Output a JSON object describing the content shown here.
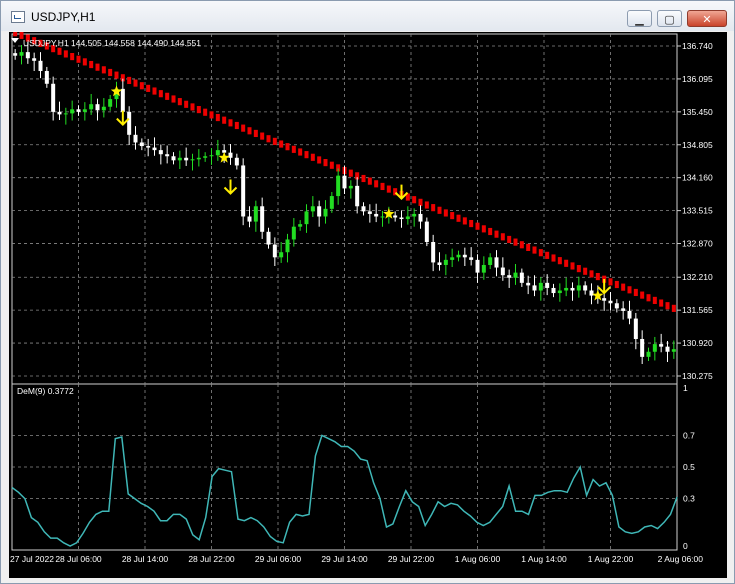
{
  "window": {
    "title": "USDJPY,H1",
    "minimize_icon": "minimize-icon",
    "maximize_icon": "maximize-icon",
    "close_icon": "close-icon"
  },
  "colors": {
    "background": "#000000",
    "grid": "#8a8a8a",
    "bull_candle": "#22dd22",
    "bear_candle": "#ffffff",
    "ma_line": "#ee0000",
    "signal_marker": "#ffee00",
    "dem_line": "#3fb7b7",
    "text": "#ffffff"
  },
  "chart_data": [
    {
      "type": "candlestick",
      "header": "USDJPY,H1  144.505 144.558 144.490 144.551",
      "ylim": [
        130.275,
        136.74
      ],
      "y_ticks": [
        "136.740",
        "136.095",
        "135.450",
        "134.805",
        "134.160",
        "133.515",
        "132.870",
        "132.210",
        "131.565",
        "130.920",
        "130.275"
      ],
      "x_ticks": [
        "27 Jul 2022",
        "28 Jul 06:00",
        "28 Jul 14:00",
        "28 Jul 22:00",
        "29 Jul 06:00",
        "29 Jul 14:00",
        "29 Jul 22:00",
        "1 Aug 06:00",
        "1 Aug 14:00",
        "1 Aug 22:00",
        "2 Aug 06:00"
      ],
      "grid": true,
      "candles_close": [
        136.55,
        136.62,
        136.5,
        136.45,
        136.25,
        136.0,
        135.45,
        135.4,
        135.42,
        135.5,
        135.45,
        135.5,
        135.6,
        135.48,
        135.55,
        135.7,
        135.9,
        135.45,
        135.0,
        134.85,
        134.78,
        134.75,
        134.7,
        134.62,
        134.58,
        134.5,
        134.55,
        134.5,
        134.52,
        134.55,
        134.58,
        134.6,
        134.7,
        134.65,
        134.55,
        134.4,
        133.4,
        133.3,
        133.6,
        133.1,
        132.85,
        132.6,
        132.7,
        132.95,
        133.2,
        133.25,
        133.5,
        133.6,
        133.4,
        133.55,
        133.8,
        134.2,
        133.95,
        134.0,
        133.6,
        133.5,
        133.45,
        133.4,
        133.4,
        133.42,
        133.38,
        133.35,
        133.4,
        133.45,
        133.3,
        132.9,
        132.5,
        132.45,
        132.55,
        132.6,
        132.65,
        132.6,
        132.55,
        132.3,
        132.45,
        132.6,
        132.4,
        132.25,
        132.2,
        132.3,
        132.1,
        132.05,
        131.95,
        132.1,
        132.0,
        131.9,
        131.95,
        132.0,
        131.95,
        132.05,
        131.95,
        131.85,
        131.8,
        131.75,
        131.7,
        131.6,
        131.55,
        131.4,
        131.0,
        130.65,
        130.75,
        130.9,
        130.85,
        130.75,
        130.8
      ],
      "ma_values": [
        137.0,
        131.6
      ],
      "signals": [
        {
          "type": "star",
          "index": 16,
          "price": 135.85
        },
        {
          "type": "arrow-down",
          "index": 17,
          "price": 135.2
        },
        {
          "type": "star",
          "index": 33,
          "price": 134.55
        },
        {
          "type": "arrow-down",
          "index": 34,
          "price": 133.85
        },
        {
          "type": "star",
          "index": 59,
          "price": 133.45
        },
        {
          "type": "arrow-down",
          "index": 61,
          "price": 133.75
        },
        {
          "type": "star",
          "index": 92,
          "price": 131.85
        },
        {
          "type": "arrow-down",
          "index": 93,
          "price": 131.9
        }
      ]
    },
    {
      "type": "line",
      "header": "DeM(9) 0.3772",
      "ylim": [
        0,
        1
      ],
      "y_ticks": [
        "1",
        "0.7",
        "0.5",
        "0.3",
        "0"
      ],
      "series": [
        {
          "name": "DeM(9)",
          "values": [
            0.37,
            0.34,
            0.3,
            0.18,
            0.15,
            0.09,
            0.05,
            0.05,
            0.02,
            0.0,
            0.02,
            0.08,
            0.15,
            0.2,
            0.22,
            0.22,
            0.68,
            0.69,
            0.33,
            0.3,
            0.27,
            0.25,
            0.22,
            0.16,
            0.16,
            0.2,
            0.2,
            0.17,
            0.07,
            0.04,
            0.18,
            0.44,
            0.49,
            0.48,
            0.47,
            0.17,
            0.16,
            0.18,
            0.16,
            0.12,
            0.06,
            0.03,
            0.02,
            0.15,
            0.2,
            0.19,
            0.2,
            0.57,
            0.7,
            0.68,
            0.66,
            0.63,
            0.63,
            0.6,
            0.55,
            0.54,
            0.4,
            0.3,
            0.12,
            0.14,
            0.25,
            0.35,
            0.28,
            0.25,
            0.13,
            0.2,
            0.28,
            0.25,
            0.27,
            0.26,
            0.22,
            0.19,
            0.15,
            0.13,
            0.15,
            0.2,
            0.25,
            0.38,
            0.22,
            0.22,
            0.2,
            0.32,
            0.32,
            0.34,
            0.35,
            0.35,
            0.34,
            0.43,
            0.5,
            0.32,
            0.42,
            0.38,
            0.4,
            0.32,
            0.12,
            0.09,
            0.08,
            0.09,
            0.12,
            0.13,
            0.11,
            0.15,
            0.2,
            0.31
          ]
        }
      ]
    }
  ]
}
